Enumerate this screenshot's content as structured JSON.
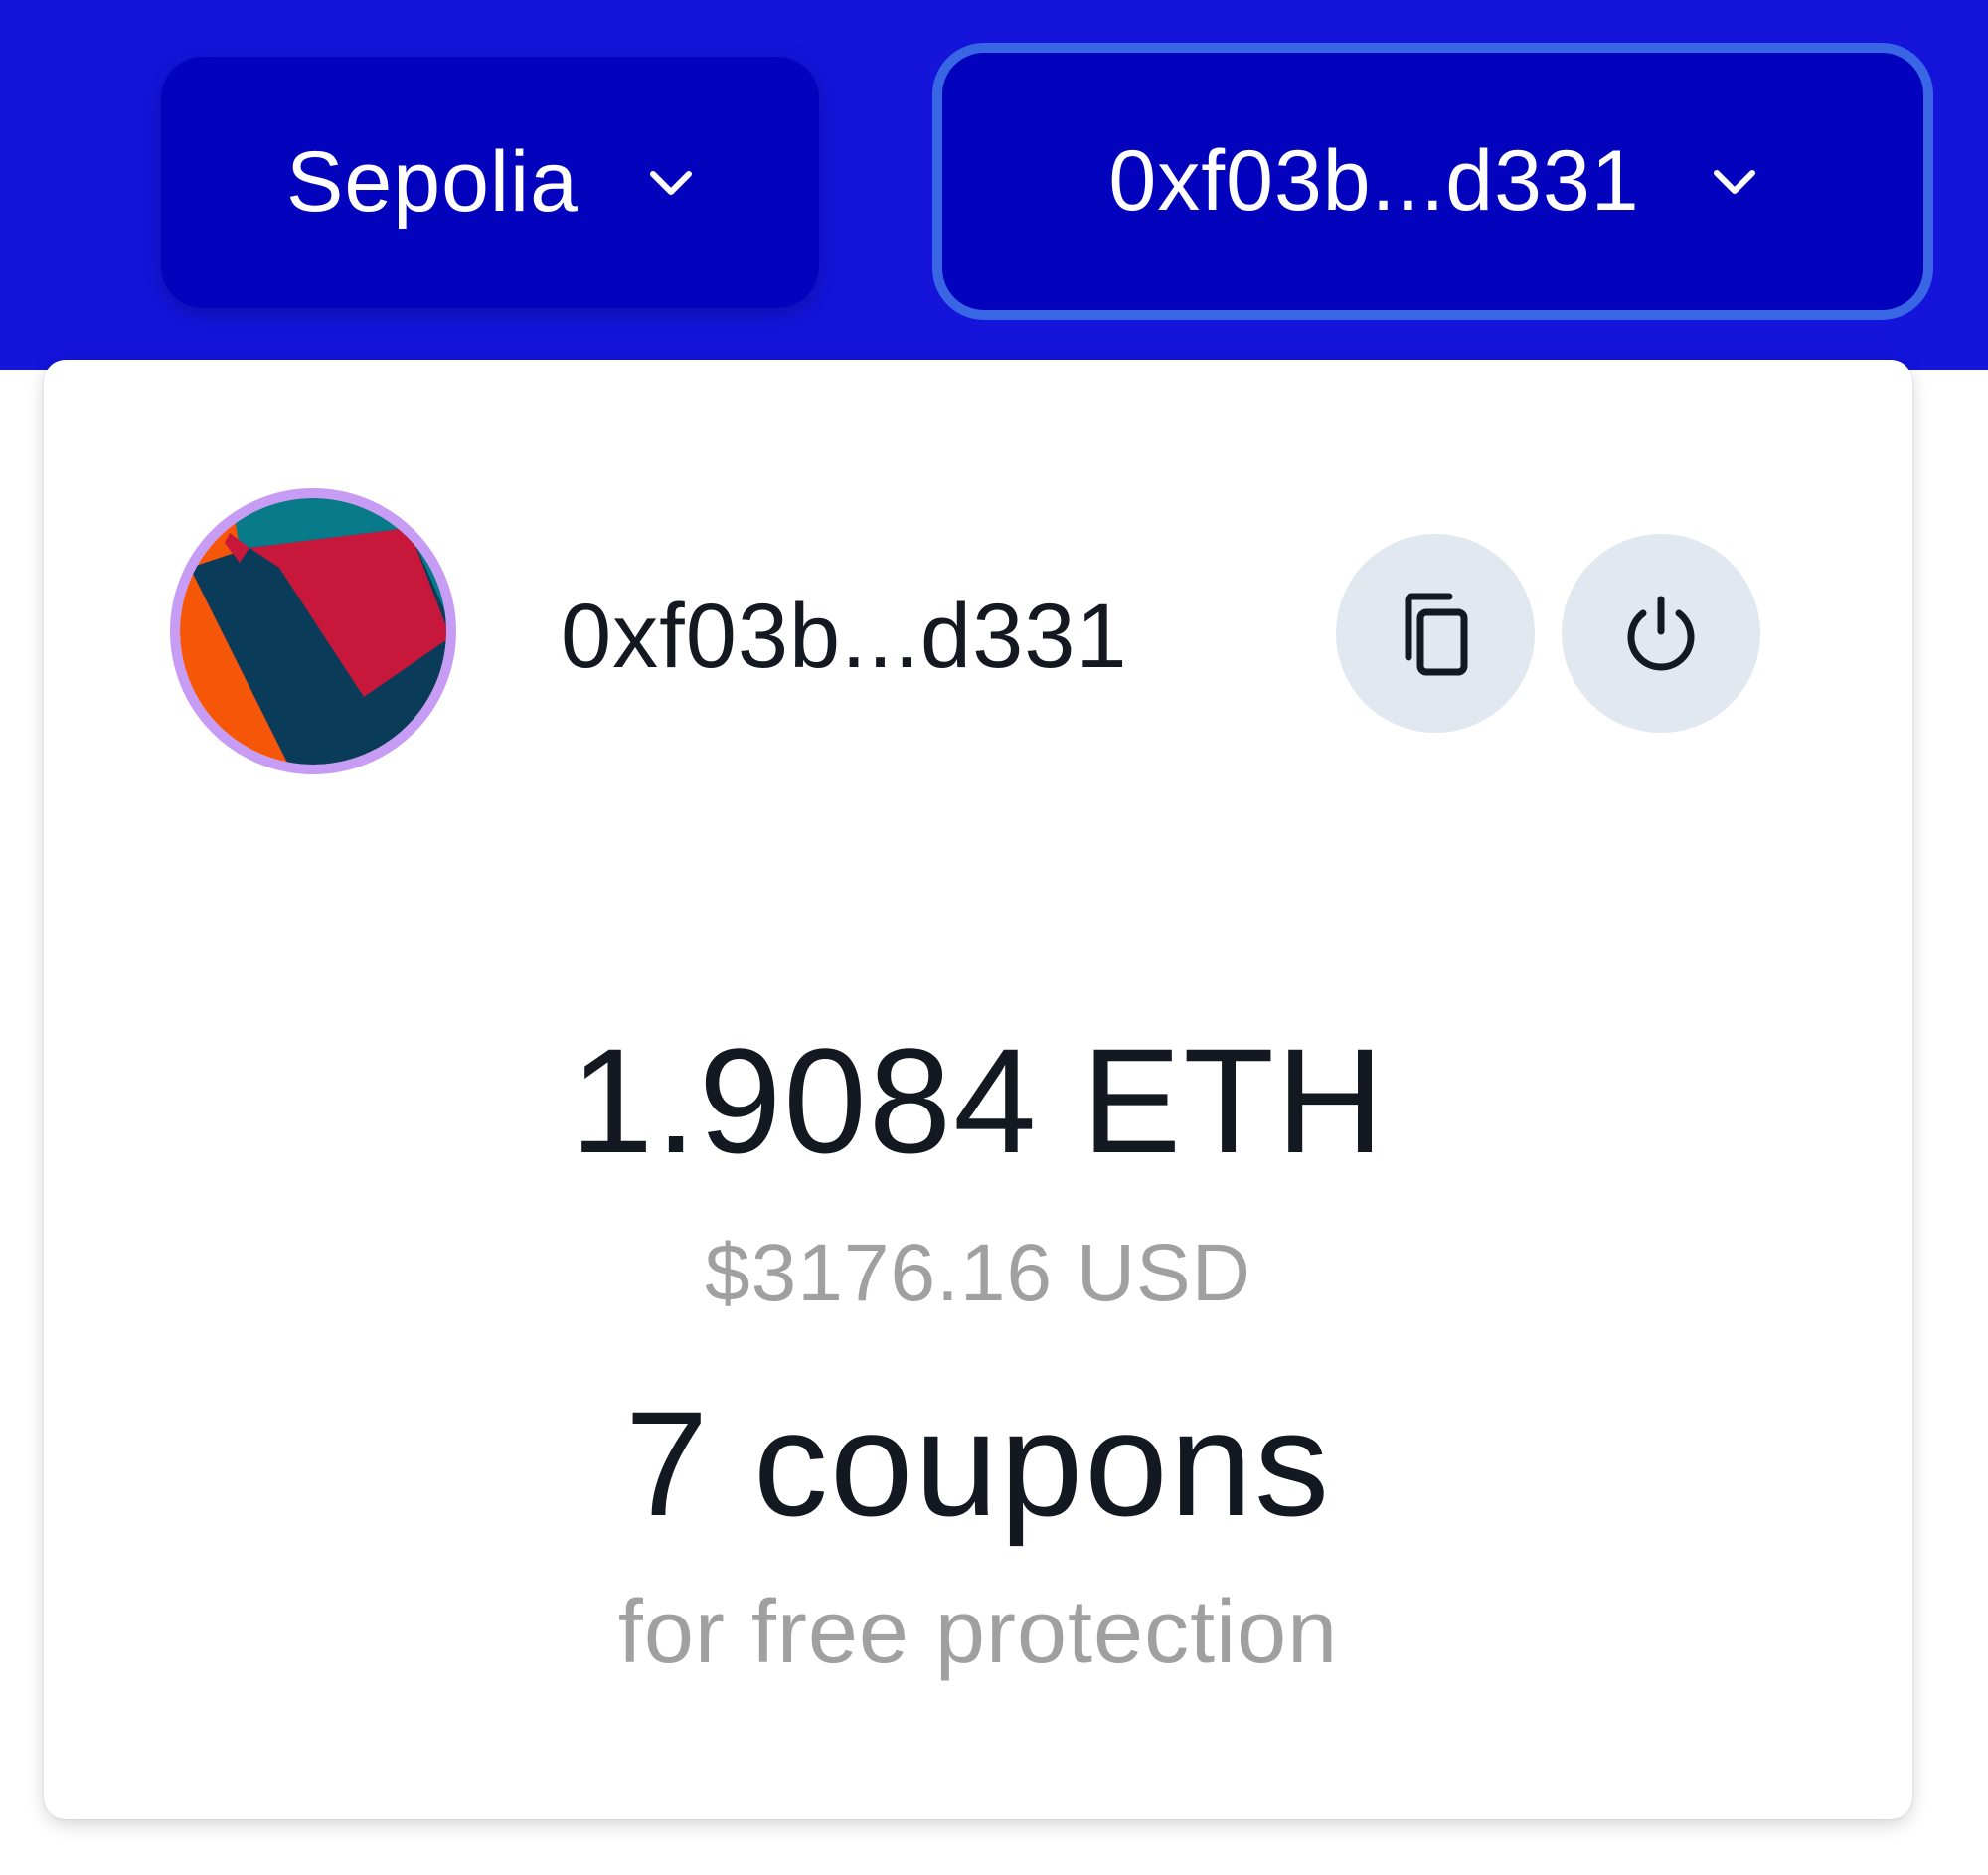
{
  "header": {
    "background": "#1414db",
    "network_selector": {
      "label": "Sepolia",
      "icon": "chevron-down-icon"
    },
    "account_selector": {
      "label": "0xf03b...d331",
      "icon": "chevron-down-icon"
    }
  },
  "account_card": {
    "avatar": {
      "icon": "identicon-avatar",
      "ring_color": "#c69cf5",
      "colors": [
        "#f65608",
        "#c7173b",
        "#087a8a",
        "#0a3c5a"
      ]
    },
    "address": "0xf03b...d331",
    "copy_button_icon": "copy-icon",
    "disconnect_button_icon": "power-icon",
    "eth_balance": "1.9084 ETH",
    "usd_balance": "$3176.16 USD",
    "coupons": "7 coupons",
    "coupons_caption": "for free protection"
  }
}
